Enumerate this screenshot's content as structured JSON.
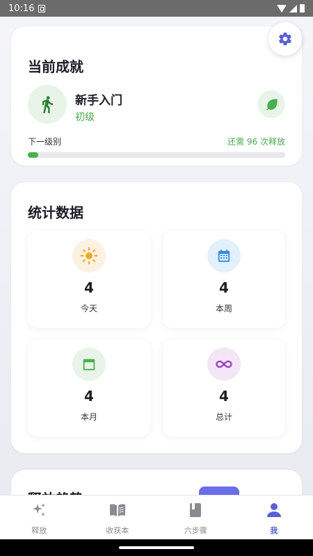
{
  "status_bar": {
    "time": "10:16"
  },
  "achievement": {
    "title": "当前成就",
    "level_name": "新手入门",
    "level_tier": "初级",
    "next_level_label": "下一级别",
    "remaining_text": "还需 96 次释放",
    "progress_fraction": 0.04
  },
  "stats": {
    "title": "统计数据",
    "tiles": [
      {
        "value": "4",
        "label": "今天",
        "icon": "sun-icon",
        "color": "#f5a623",
        "bg": "#fdf1e2"
      },
      {
        "value": "4",
        "label": "本周",
        "icon": "calendar-week-icon",
        "color": "#2e8be0",
        "bg": "#e4f1fb"
      },
      {
        "value": "4",
        "label": "本月",
        "icon": "calendar-icon",
        "color": "#4caf50",
        "bg": "#e8f4e8"
      },
      {
        "value": "4",
        "label": "总计",
        "icon": "infinity-icon",
        "color": "#9c3fb5",
        "bg": "#f3e6f6"
      }
    ]
  },
  "partial_section": {
    "title": "释放趋势"
  },
  "nav": {
    "items": [
      {
        "label": "释放",
        "icon": "sparkle-icon"
      },
      {
        "label": "收获本",
        "icon": "book-open-icon"
      },
      {
        "label": "六步骤",
        "icon": "book-icon"
      },
      {
        "label": "我",
        "icon": "person-icon"
      }
    ],
    "active_index": 3
  },
  "colors": {
    "accent": "#5b5fd6",
    "green": "#4caf50"
  }
}
